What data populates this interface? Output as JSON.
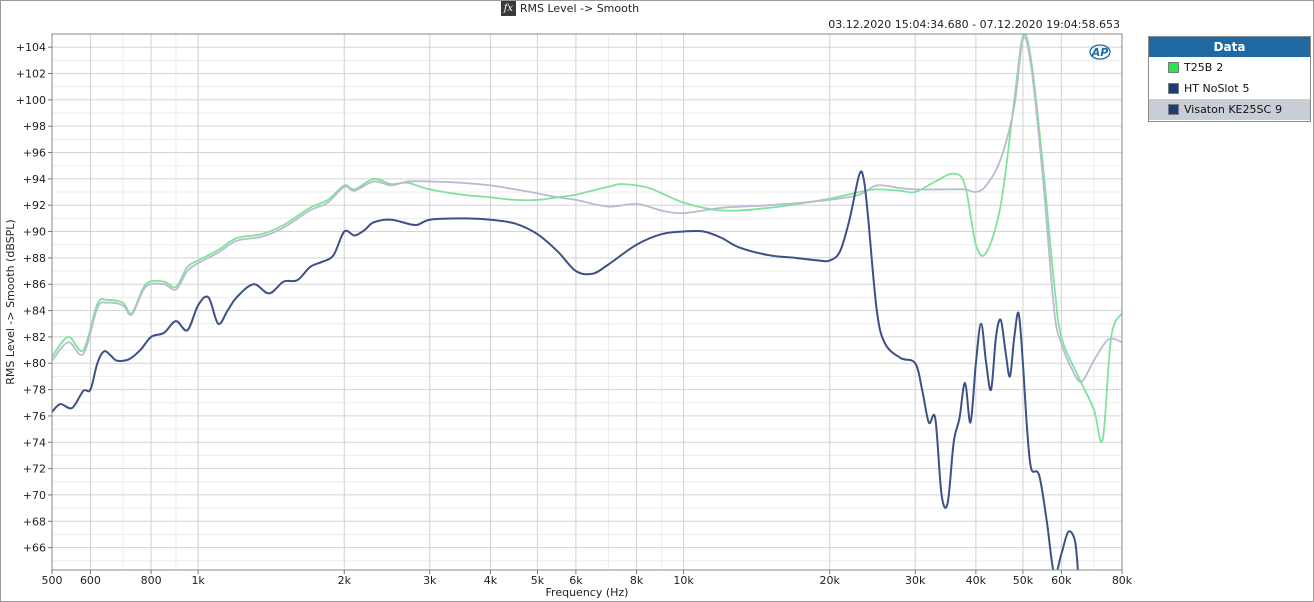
{
  "window": {
    "title": "RMS Level -> Smooth",
    "time_range": "03.12.2020 15:04:34.680 - 07.12.2020 19:04:58.653",
    "logo_text": "AP"
  },
  "legend": {
    "title": "Data",
    "items": [
      {
        "label": "T25B",
        "number": "2",
        "color": "#22e84e"
      },
      {
        "label": "HT NoSlot",
        "number": "5",
        "color": "#1d3d7a"
      },
      {
        "label": "Visaton KE25SC",
        "number": "9",
        "color": "#1d3d7a"
      }
    ]
  },
  "chart_data": {
    "type": "line",
    "xlabel": "Frequency (Hz)",
    "ylabel": "RMS Level -> Smooth (dBSPL)",
    "xscale": "log",
    "xlim": [
      500,
      80000
    ],
    "ylim": [
      64.3,
      105
    ],
    "grid": true,
    "x_ticks": [
      {
        "v": 500,
        "l": "500"
      },
      {
        "v": 600,
        "l": "600"
      },
      {
        "v": 800,
        "l": "800"
      },
      {
        "v": 1000,
        "l": "1k"
      },
      {
        "v": 2000,
        "l": "2k"
      },
      {
        "v": 3000,
        "l": "3k"
      },
      {
        "v": 4000,
        "l": "4k"
      },
      {
        "v": 5000,
        "l": "5k"
      },
      {
        "v": 6000,
        "l": "6k"
      },
      {
        "v": 8000,
        "l": "8k"
      },
      {
        "v": 10000,
        "l": "10k"
      },
      {
        "v": 20000,
        "l": "20k"
      },
      {
        "v": 30000,
        "l": "30k"
      },
      {
        "v": 40000,
        "l": "40k"
      },
      {
        "v": 50000,
        "l": "50k"
      },
      {
        "v": 60000,
        "l": "60k"
      },
      {
        "v": 80000,
        "l": "80k"
      }
    ],
    "y_ticks": [
      {
        "v": 66,
        "l": "+66"
      },
      {
        "v": 68,
        "l": "+68"
      },
      {
        "v": 70,
        "l": "+70"
      },
      {
        "v": 72,
        "l": "+72"
      },
      {
        "v": 74,
        "l": "+74"
      },
      {
        "v": 76,
        "l": "+76"
      },
      {
        "v": 78,
        "l": "+78"
      },
      {
        "v": 80,
        "l": "+80"
      },
      {
        "v": 82,
        "l": "+82"
      },
      {
        "v": 84,
        "l": "+84"
      },
      {
        "v": 86,
        "l": "+86"
      },
      {
        "v": 88,
        "l": "+88"
      },
      {
        "v": 90,
        "l": "+90"
      },
      {
        "v": 92,
        "l": "+92"
      },
      {
        "v": 94,
        "l": "+94"
      },
      {
        "v": 96,
        "l": "+96"
      },
      {
        "v": 98,
        "l": "+98"
      },
      {
        "v": 100,
        "l": "+100"
      },
      {
        "v": 102,
        "l": "+102"
      },
      {
        "v": 104,
        "l": "+104"
      }
    ],
    "series": [
      {
        "name": "T25B 2",
        "color": "#7fe39a",
        "x": [
          500,
          540,
          580,
          620,
          650,
          700,
          730,
          780,
          850,
          900,
          950,
          1000,
          1100,
          1200,
          1350,
          1500,
          1700,
          1850,
          2000,
          2100,
          2300,
          2500,
          2700,
          3000,
          3500,
          4000,
          4500,
          5000,
          5500,
          6000,
          7000,
          7500,
          8500,
          10000,
          12000,
          15000,
          20000,
          23000,
          25000,
          28000,
          30000,
          33000,
          36000,
          38000,
          40000,
          42000,
          45000,
          48000,
          50000,
          52000,
          55000,
          58000,
          60000,
          65000,
          70000,
          73000,
          76000,
          80000
        ],
        "y": [
          80.5,
          82.0,
          81.0,
          84.5,
          84.8,
          84.6,
          83.8,
          86.0,
          86.2,
          85.8,
          87.3,
          87.8,
          88.6,
          89.5,
          89.8,
          90.5,
          91.8,
          92.4,
          93.5,
          93.2,
          94.0,
          93.6,
          93.7,
          93.2,
          92.8,
          92.6,
          92.4,
          92.4,
          92.6,
          92.8,
          93.4,
          93.6,
          93.3,
          92.2,
          91.6,
          91.8,
          92.5,
          93.0,
          93.2,
          93.1,
          93.0,
          93.8,
          94.4,
          93.5,
          89.0,
          88.4,
          92.0,
          100.0,
          104.8,
          103.0,
          95.0,
          86.0,
          82.0,
          79.0,
          76.5,
          74.2,
          82.0,
          83.8
        ]
      },
      {
        "name": "Visaton KE25SC 9",
        "color": "#b8bccf",
        "x": [
          500,
          540,
          580,
          620,
          650,
          700,
          730,
          780,
          850,
          900,
          950,
          1000,
          1100,
          1200,
          1350,
          1500,
          1700,
          1850,
          2000,
          2100,
          2300,
          2500,
          2700,
          3000,
          3500,
          4000,
          4500,
          5000,
          5500,
          6000,
          7000,
          8000,
          9000,
          10000,
          12000,
          15000,
          20000,
          23000,
          25000,
          28000,
          30000,
          35000,
          38000,
          40000,
          42000,
          45000,
          48000,
          50000,
          52000,
          55000,
          58000,
          60000,
          63000,
          66000,
          70000,
          75000,
          80000
        ],
        "y": [
          80.2,
          81.6,
          80.7,
          84.2,
          84.6,
          84.4,
          83.7,
          85.8,
          86.0,
          85.6,
          87.0,
          87.6,
          88.4,
          89.3,
          89.6,
          90.3,
          91.6,
          92.2,
          93.4,
          93.1,
          93.8,
          93.5,
          93.8,
          93.8,
          93.7,
          93.5,
          93.2,
          92.9,
          92.6,
          92.4,
          91.9,
          92.1,
          91.6,
          91.4,
          91.8,
          92.0,
          92.4,
          92.8,
          93.5,
          93.3,
          93.2,
          93.2,
          93.2,
          93.0,
          93.5,
          95.5,
          99.5,
          104.6,
          102.5,
          94.0,
          84.0,
          81.5,
          79.6,
          78.6,
          80.2,
          81.8,
          81.6
        ]
      },
      {
        "name": "HT NoSlot 5",
        "color": "#3d5185",
        "x": [
          500,
          520,
          550,
          580,
          600,
          620,
          640,
          660,
          680,
          720,
          760,
          800,
          850,
          900,
          950,
          1000,
          1050,
          1100,
          1150,
          1200,
          1300,
          1400,
          1500,
          1600,
          1700,
          1800,
          1900,
          2000,
          2100,
          2200,
          2300,
          2500,
          2800,
          3000,
          3500,
          4000,
          4500,
          5000,
          5500,
          6000,
          6500,
          7000,
          8000,
          9000,
          10000,
          11000,
          12000,
          13000,
          15000,
          17000,
          19000,
          20000,
          21000,
          22000,
          23000,
          23500,
          24000,
          25000,
          26000,
          28000,
          30000,
          31000,
          32000,
          33000,
          34000,
          35000,
          36000,
          37000,
          38000,
          39000,
          40000,
          41000,
          42000,
          43000,
          44000,
          45000,
          46000,
          47000,
          48000,
          49000,
          50000,
          51000,
          52000,
          54000,
          56000,
          58000,
          60000,
          62000,
          64000,
          65000
        ],
        "y": [
          76.3,
          76.9,
          76.6,
          77.9,
          78.0,
          80.0,
          80.9,
          80.6,
          80.2,
          80.3,
          81.0,
          82.0,
          82.3,
          83.2,
          82.5,
          84.4,
          85.0,
          83.0,
          84.0,
          85.0,
          86.0,
          85.3,
          86.2,
          86.3,
          87.3,
          87.7,
          88.2,
          90.0,
          89.7,
          90.1,
          90.7,
          90.9,
          90.5,
          90.9,
          91.0,
          90.9,
          90.6,
          89.8,
          88.5,
          87.0,
          86.8,
          87.5,
          89.0,
          89.8,
          90.0,
          90.0,
          89.5,
          88.8,
          88.2,
          88.0,
          87.8,
          87.8,
          88.5,
          91.0,
          94.3,
          94.0,
          91.0,
          84.0,
          81.5,
          80.4,
          80.0,
          78.0,
          75.5,
          75.8,
          70.0,
          69.4,
          74.0,
          75.8,
          78.5,
          75.5,
          80.0,
          83.0,
          80.0,
          78.0,
          82.0,
          83.3,
          81.0,
          79.0,
          82.0,
          83.8,
          80.0,
          75.0,
          72.0,
          71.5,
          68.0,
          64.0,
          65.5,
          67.2,
          66.5,
          64.0
        ]
      }
    ]
  }
}
